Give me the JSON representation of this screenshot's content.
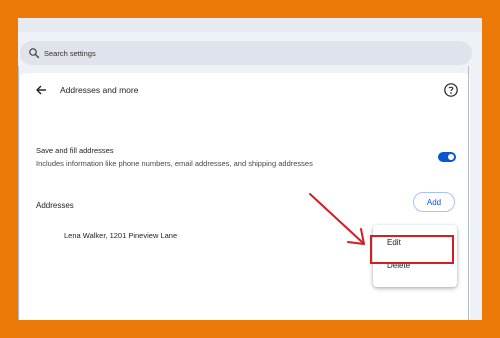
{
  "search": {
    "placeholder": "Search settings"
  },
  "header": {
    "title": "Addresses and more"
  },
  "save_fill": {
    "title": "Save and fill addresses",
    "description": "Includes information like phone numbers, email addresses, and shipping addresses",
    "enabled": true
  },
  "addresses": {
    "label": "Addresses",
    "add_label": "Add",
    "items": [
      "Lena Walker, 1201 Pineview Lane"
    ]
  },
  "menu": {
    "edit_label": "Edit",
    "delete_label": "Delete"
  },
  "icons": {
    "search": "search-icon",
    "back": "arrow-left-icon",
    "help": "help-circle-icon"
  },
  "colors": {
    "frame": "#ec7a08",
    "accent": "#0b57d0",
    "annotation": "#d41c23"
  }
}
